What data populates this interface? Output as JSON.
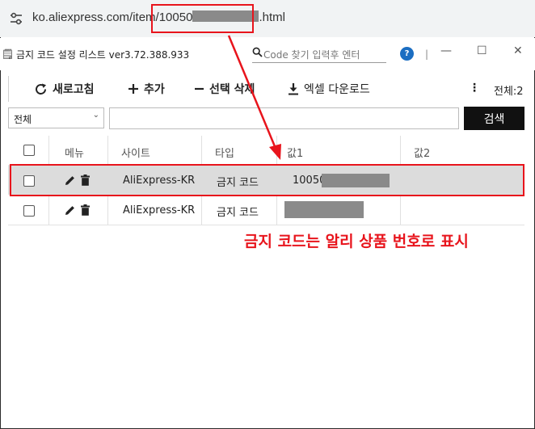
{
  "browser": {
    "url_prefix": "ko.aliexpress.com/item/10050",
    "url_suffix": ".html"
  },
  "window": {
    "title": "금지 코드  설정 리스트  ver3.72.388.933",
    "search_placeholder": "Code 찾기 입력후 엔터",
    "help_label": "?",
    "separator": "|",
    "minimize": "—",
    "maximize": "☐",
    "close": "✕"
  },
  "toolbar": {
    "refresh": "새로고침",
    "add": "추가",
    "delete_selected": "선택 삭제",
    "excel_download": "엑셀 다운로드",
    "more": "⋮",
    "total": "전체:2"
  },
  "search": {
    "filter_value": "전체",
    "button": "검색",
    "input_value": ""
  },
  "table": {
    "headers": [
      "메뉴",
      "사이트",
      "타입",
      "값1",
      "값2"
    ],
    "rows": [
      {
        "site": "AliExpress-KR",
        "type": "금지 코드",
        "value1": "10050",
        "value2": ""
      },
      {
        "site": "AliExpress-KR",
        "type": "금지 코드",
        "value1": "",
        "value2": ""
      }
    ]
  },
  "annotation": {
    "text": "금지 코드는 알리 상품 번호로 표시",
    "color": "#e8141c"
  },
  "colors": {
    "accent_red": "#e8141c",
    "search_button": "#111111",
    "help_blue": "#1b6ec2",
    "mask_gray": "#8a8a8a"
  }
}
